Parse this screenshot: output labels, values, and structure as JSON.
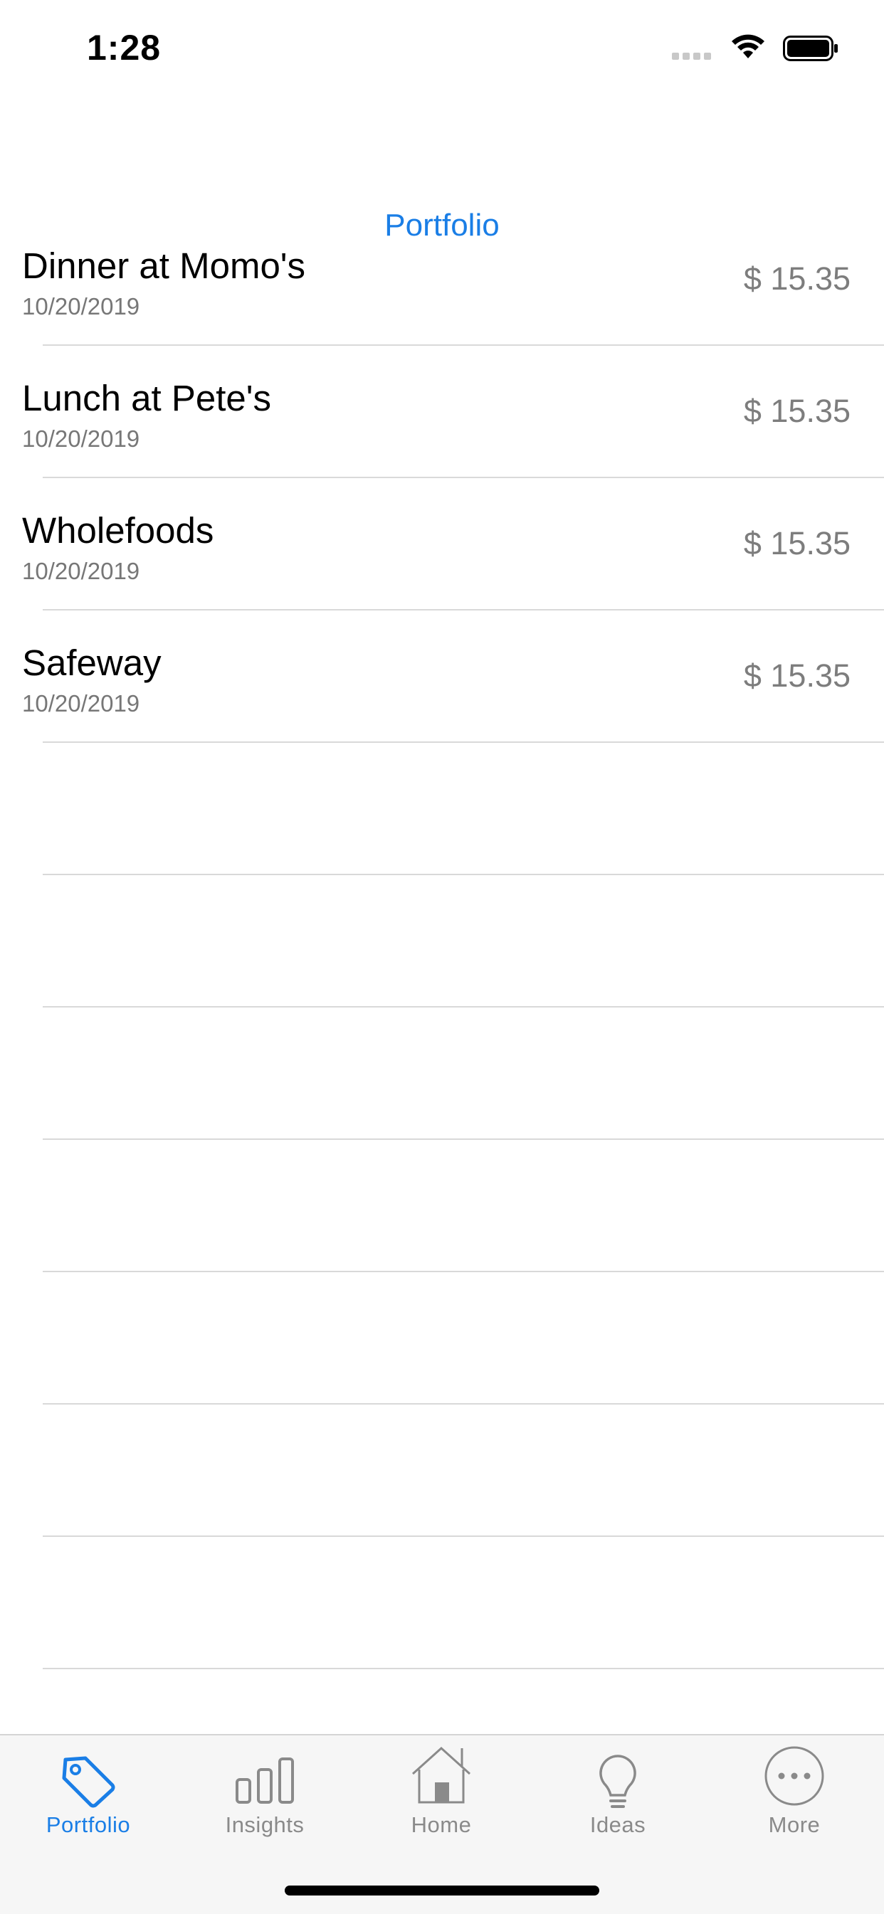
{
  "status": {
    "time": "1:28"
  },
  "nav": {
    "title": "Portfolio"
  },
  "transactions": [
    {
      "title": "Dinner at Momo's",
      "date": "10/20/2019",
      "amount": "$ 15.35"
    },
    {
      "title": "Lunch at Pete's",
      "date": "10/20/2019",
      "amount": "$ 15.35"
    },
    {
      "title": "Wholefoods",
      "date": "10/20/2019",
      "amount": "$ 15.35"
    },
    {
      "title": "Safeway",
      "date": "10/20/2019",
      "amount": "$ 15.35"
    }
  ],
  "tabs": [
    {
      "label": "Portfolio",
      "icon": "tag-icon",
      "active": true
    },
    {
      "label": "Insights",
      "icon": "bar-chart-icon",
      "active": false
    },
    {
      "label": "Home",
      "icon": "house-icon",
      "active": false
    },
    {
      "label": "Ideas",
      "icon": "lightbulb-icon",
      "active": false
    },
    {
      "label": "More",
      "icon": "ellipsis-circle-icon",
      "active": false
    }
  ],
  "colors": {
    "accent": "#1a7ee6",
    "inactive": "#8a8a8a",
    "separator": "#d9d9d9"
  }
}
